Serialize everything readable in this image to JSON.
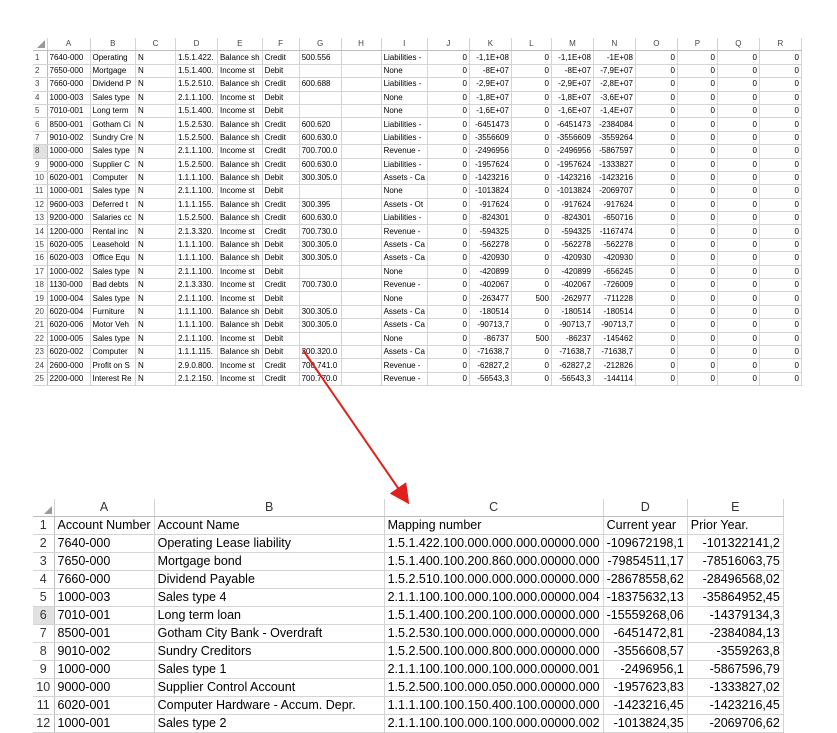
{
  "colors": {
    "arrow": "#e0201c",
    "grid_line": "#d4d4d4",
    "selected_row_header": "#e1e1e1"
  },
  "top": {
    "columns": [
      "A",
      "B",
      "C",
      "D",
      "E",
      "F",
      "G",
      "H",
      "I",
      "J",
      "K",
      "L",
      "M",
      "N",
      "O",
      "P",
      "Q",
      "R"
    ],
    "rows": [
      {
        "n": "1",
        "cells": [
          "7640-000",
          "Operating",
          "N",
          "1.5.1.422.",
          "Balance sh",
          "Credit",
          "500.556",
          "",
          "Liabilities -",
          "0",
          "-1,1E+08",
          "0",
          "-1,1E+08",
          "-1E+08",
          "0",
          "0",
          "0",
          "0"
        ]
      },
      {
        "n": "2",
        "cells": [
          "7650-000",
          "Mortgage",
          "N",
          "1.5.1.400.",
          "Income st",
          "Debit",
          "",
          "",
          "None",
          "0",
          "-8E+07",
          "0",
          "-8E+07",
          "-7,9E+07",
          "0",
          "0",
          "0",
          "0"
        ]
      },
      {
        "n": "3",
        "cells": [
          "7660-000",
          "Dividend P",
          "N",
          "1.5.2.510.",
          "Balance sh",
          "Credit",
          "600.688",
          "",
          "Liabilities -",
          "0",
          "-2,9E+07",
          "0",
          "-2,9E+07",
          "-2,8E+07",
          "0",
          "0",
          "0",
          "0"
        ]
      },
      {
        "n": "4",
        "cells": [
          "1000-003",
          "Sales type",
          "N",
          "2.1.1.100.",
          "Income st",
          "Debit",
          "",
          "",
          "None",
          "0",
          "-1,8E+07",
          "0",
          "-1,8E+07",
          "-3,6E+07",
          "0",
          "0",
          "0",
          "0"
        ]
      },
      {
        "n": "5",
        "cells": [
          "7010-001",
          "Long term",
          "N",
          "1.5.1.400.",
          "Income st",
          "Debit",
          "",
          "",
          "None",
          "0",
          "-1,6E+07",
          "0",
          "-1,6E+07",
          "-1,4E+07",
          "0",
          "0",
          "0",
          "0"
        ]
      },
      {
        "n": "6",
        "cells": [
          "8500-001",
          "Gotham Ci",
          "N",
          "1.5.2.530.",
          "Balance sh",
          "Credit",
          "600.620",
          "",
          "Liabilities -",
          "0",
          "-6451473",
          "0",
          "-6451473",
          "-2384084",
          "0",
          "0",
          "0",
          "0"
        ]
      },
      {
        "n": "7",
        "cells": [
          "9010-002",
          "Sundry Cre",
          "N",
          "1.5.2.500.",
          "Balance sh",
          "Credit",
          "600.630.0",
          "",
          "Liabilities -",
          "0",
          "-3556609",
          "0",
          "-3556609",
          "-3559264",
          "0",
          "0",
          "0",
          "0"
        ]
      },
      {
        "n": "8",
        "cells": [
          "1000-000",
          "Sales type",
          "N",
          "2.1.1.100.",
          "Income st",
          "Credit",
          "700.700.0",
          "",
          "Revenue -",
          "0",
          "-2496956",
          "0",
          "-2496956",
          "-5867597",
          "0",
          "0",
          "0",
          "0"
        ]
      },
      {
        "n": "9",
        "cells": [
          "9000-000",
          "Supplier C",
          "N",
          "1.5.2.500.",
          "Balance sh",
          "Credit",
          "600.630.0",
          "",
          "Liabilities -",
          "0",
          "-1957624",
          "0",
          "-1957624",
          "-1333827",
          "0",
          "0",
          "0",
          "0"
        ]
      },
      {
        "n": "10",
        "cells": [
          "6020-001",
          "Computer",
          "N",
          "1.1.1.100.",
          "Balance sh",
          "Debit",
          "300.305.0",
          "",
          "Assets - Ca",
          "0",
          "-1423216",
          "0",
          "-1423216",
          "-1423216",
          "0",
          "0",
          "0",
          "0"
        ]
      },
      {
        "n": "11",
        "cells": [
          "1000-001",
          "Sales type",
          "N",
          "2.1.1.100.",
          "Income st",
          "Debit",
          "",
          "",
          "None",
          "0",
          "-1013824",
          "0",
          "-1013824",
          "-2069707",
          "0",
          "0",
          "0",
          "0"
        ]
      },
      {
        "n": "12",
        "cells": [
          "9600-003",
          "Deferred t",
          "N",
          "1.1.1.155.",
          "Balance sh",
          "Credit",
          "300.395",
          "",
          "Assets - Ot",
          "0",
          "-917624",
          "0",
          "-917624",
          "-917624",
          "0",
          "0",
          "0",
          "0"
        ]
      },
      {
        "n": "13",
        "cells": [
          "9200-000",
          "Salaries cc",
          "N",
          "1.5.2.500.",
          "Balance sh",
          "Credit",
          "600.630.0",
          "",
          "Liabilities -",
          "0",
          "-824301",
          "0",
          "-824301",
          "-650716",
          "0",
          "0",
          "0",
          "0"
        ]
      },
      {
        "n": "14",
        "cells": [
          "1200-000",
          "Rental inc",
          "N",
          "2.1.3.320.",
          "Income st",
          "Credit",
          "700.730.0",
          "",
          "Revenue -",
          "0",
          "-594325",
          "0",
          "-594325",
          "-1167474",
          "0",
          "0",
          "0",
          "0"
        ]
      },
      {
        "n": "15",
        "cells": [
          "6020-005",
          "Leasehold",
          "N",
          "1.1.1.100.",
          "Balance sh",
          "Debit",
          "300.305.0",
          "",
          "Assets - Ca",
          "0",
          "-562278",
          "0",
          "-562278",
          "-562278",
          "0",
          "0",
          "0",
          "0"
        ]
      },
      {
        "n": "16",
        "cells": [
          "6020-003",
          "Office Equ",
          "N",
          "1.1.1.100.",
          "Balance sh",
          "Debit",
          "300.305.0",
          "",
          "Assets - Ca",
          "0",
          "-420930",
          "0",
          "-420930",
          "-420930",
          "0",
          "0",
          "0",
          "0"
        ]
      },
      {
        "n": "17",
        "cells": [
          "1000-002",
          "Sales type",
          "N",
          "2.1.1.100.",
          "Income st",
          "Debit",
          "",
          "",
          "None",
          "0",
          "-420899",
          "0",
          "-420899",
          "-656245",
          "0",
          "0",
          "0",
          "0"
        ]
      },
      {
        "n": "18",
        "cells": [
          "1130-000",
          "Bad debts",
          "N",
          "2.1.3.330.",
          "Income st",
          "Credit",
          "700.730.0",
          "",
          "Revenue -",
          "0",
          "-402067",
          "0",
          "-402067",
          "-726009",
          "0",
          "0",
          "0",
          "0"
        ]
      },
      {
        "n": "19",
        "cells": [
          "1000-004",
          "Sales type",
          "N",
          "2.1.1.100.",
          "Income st",
          "Debit",
          "",
          "",
          "None",
          "0",
          "-263477",
          "500",
          "-262977",
          "-711228",
          "0",
          "0",
          "0",
          "0"
        ]
      },
      {
        "n": "20",
        "cells": [
          "6020-004",
          "Furniture",
          "N",
          "1.1.1.100.",
          "Balance sh",
          "Debit",
          "300.305.0",
          "",
          "Assets - Ca",
          "0",
          "-180514",
          "0",
          "-180514",
          "-180514",
          "0",
          "0",
          "0",
          "0"
        ]
      },
      {
        "n": "21",
        "cells": [
          "6020-006",
          "Motor Veh",
          "N",
          "1.1.1.100.",
          "Balance sh",
          "Debit",
          "300.305.0",
          "",
          "Assets - Ca",
          "0",
          "-90713,7",
          "0",
          "-90713,7",
          "-90713,7",
          "0",
          "0",
          "0",
          "0"
        ]
      },
      {
        "n": "22",
        "cells": [
          "1000-005",
          "Sales type",
          "N",
          "2.1.1.100.",
          "Income st",
          "Debit",
          "",
          "",
          "None",
          "0",
          "-86737",
          "500",
          "-86237",
          "-145462",
          "0",
          "0",
          "0",
          "0"
        ]
      },
      {
        "n": "23",
        "cells": [
          "6020-002",
          "Computer",
          "N",
          "1.1.1.115.",
          "Balance sh",
          "Debit",
          "300.320.0",
          "",
          "Assets - Ca",
          "0",
          "-71638,7",
          "0",
          "-71638,7",
          "-71638,7",
          "0",
          "0",
          "0",
          "0"
        ]
      },
      {
        "n": "24",
        "cells": [
          "2600-000",
          "Profit on S",
          "N",
          "2.9.0.800.",
          "Income st",
          "Credit",
          "700.741.0",
          "",
          "Revenue -",
          "0",
          "-62827,2",
          "0",
          "-62827,2",
          "-212826",
          "0",
          "0",
          "0",
          "0"
        ]
      },
      {
        "n": "25",
        "cells": [
          "2200-000",
          "Interest Re",
          "N",
          "2.1.2.150.",
          "Income st",
          "Credit",
          "700.770.0",
          "",
          "Revenue -",
          "0",
          "-56543,3",
          "0",
          "-56543,3",
          "-144114",
          "0",
          "0",
          "0",
          "0"
        ]
      }
    ]
  },
  "bottom": {
    "columns": [
      "A",
      "B",
      "C",
      "D",
      "E"
    ],
    "rows": [
      {
        "n": "1",
        "cells": [
          "Account Number",
          "Account Name",
          "Mapping number",
          "Current year",
          "Prior Year."
        ]
      },
      {
        "n": "2",
        "cells": [
          "7640-000",
          "Operating Lease liability",
          "1.5.1.422.100.000.000.000.00000.000",
          "-109672198,1",
          "-101322141,2"
        ]
      },
      {
        "n": "3",
        "cells": [
          "7650-000",
          "Mortgage bond",
          "1.5.1.400.100.200.860.000.00000.000",
          "-79854511,17",
          "-78516063,75"
        ]
      },
      {
        "n": "4",
        "cells": [
          "7660-000",
          "Dividend Payable",
          "1.5.2.510.100.000.000.000.00000.000",
          "-28678558,62",
          "-28496568,02"
        ]
      },
      {
        "n": "5",
        "cells": [
          "1000-003",
          "Sales type 4",
          "2.1.1.100.100.000.100.000.00000.004",
          "-18375632,13",
          "-35864952,45"
        ]
      },
      {
        "n": "6",
        "cells": [
          "7010-001",
          "Long term loan",
          "1.5.1.400.100.200.100.000.00000.000",
          "-15559268,06",
          "-14379134,3"
        ]
      },
      {
        "n": "7",
        "cells": [
          "8500-001",
          "Gotham City Bank -  Overdraft",
          "1.5.2.530.100.000.000.000.00000.000",
          "-6451472,81",
          "-2384084,13"
        ]
      },
      {
        "n": "8",
        "cells": [
          "9010-002",
          "Sundry Creditors",
          "1.5.2.500.100.000.800.000.00000.000",
          "-3556608,57",
          "-3559263,8"
        ]
      },
      {
        "n": "9",
        "cells": [
          "1000-000",
          "Sales type 1",
          "2.1.1.100.100.000.100.000.00000.001",
          "-2496956,1",
          "-5867596,79"
        ]
      },
      {
        "n": "10",
        "cells": [
          "9000-000",
          "Supplier Control Account",
          "1.5.2.500.100.000.050.000.00000.000",
          "-1957623,83",
          "-1333827,02"
        ]
      },
      {
        "n": "11",
        "cells": [
          "6020-001",
          "Computer Hardware - Accum. Depr.",
          "1.1.1.100.100.150.400.100.00000.000",
          "-1423216,45",
          "-1423216,45"
        ]
      },
      {
        "n": "12",
        "cells": [
          "1000-001",
          "Sales type 2",
          "2.1.1.100.100.000.100.000.00000.002",
          "-1013824,35",
          "-2069706,62"
        ]
      }
    ]
  }
}
